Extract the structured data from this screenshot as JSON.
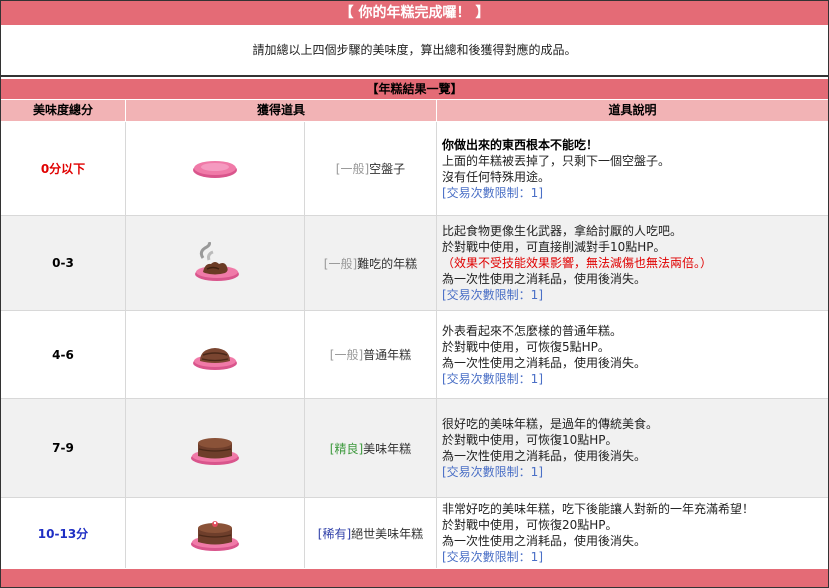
{
  "banner": {
    "title": "【 你的年糕完成囉！ 】"
  },
  "intro": {
    "text": "請加總以上四個步驟的美味度，算出總和後獲得對應的成品。"
  },
  "results": {
    "title": "【年糕結果一覽】",
    "headers": {
      "score": "美味度總分",
      "item": "獲得道具",
      "desc": "道具說明"
    },
    "rows": [
      {
        "score": "0分以下",
        "grade": "[一般]",
        "name": "空盤子",
        "image_icon": "empty-plate-icon",
        "title": "你做出來的東西根本不能吃！",
        "lines": [
          "上面的年糕被丟掉了，只剩下一個空盤子。",
          "沒有任何特殊用途。"
        ],
        "warn": "",
        "limit": "[交易次數限制：1]"
      },
      {
        "score": "0-3",
        "grade": "[一般]",
        "name": "難吃的年糕",
        "image_icon": "burnt-cake-icon",
        "title": "",
        "lines": [
          "比起食物更像生化武器，拿給討厭的人吃吧。",
          "於對戰中使用，可直接削減對手10點HP。"
        ],
        "warn": "（效果不受技能效果影響，無法減傷也無法兩倍。）",
        "lines2": [
          "為一次性使用之消耗品，使用後消失。"
        ],
        "limit": "[交易次數限制：1]"
      },
      {
        "score": "4-6",
        "grade": "[一般]",
        "name": "普通年糕",
        "image_icon": "normal-cake-icon",
        "title": "",
        "lines": [
          "外表看起來不怎麼樣的普通年糕。",
          "於對戰中使用，可恢復5點HP。",
          "為一次性使用之消耗品，使用後消失。"
        ],
        "warn": "",
        "limit": "[交易次數限制：1]"
      },
      {
        "score": "7-9",
        "grade": "[精良]",
        "name": "美味年糕",
        "image_icon": "tasty-cake-icon",
        "title": "",
        "lines": [
          "很好吃的美味年糕，是過年的傳統美食。",
          "於對戰中使用，可恢復10點HP。",
          "為一次性使用之消耗品，使用後消失。"
        ],
        "warn": "",
        "limit": "[交易次數限制：1]"
      },
      {
        "score": "10-13分",
        "grade": "[稀有]",
        "name": "絕世美味年糕",
        "image_icon": "supreme-cake-icon",
        "title": "",
        "lines": [
          "非常好吃的美味年糕，吃下後能讓人對新的一年充滿希望！",
          "於對戰中使用，可恢復20點HP。",
          "為一次性使用之消耗品，使用後消失。"
        ],
        "warn": "",
        "limit": "[交易次數限制：1]"
      }
    ]
  },
  "colors": {
    "banner": "#e46b76",
    "header": "#f2b3b5",
    "alt_row": "#f1f1f1",
    "red": "#e00000",
    "blue": "#1f2fc4",
    "fine": "#3e9a3e",
    "rare": "#2e3fa8"
  }
}
